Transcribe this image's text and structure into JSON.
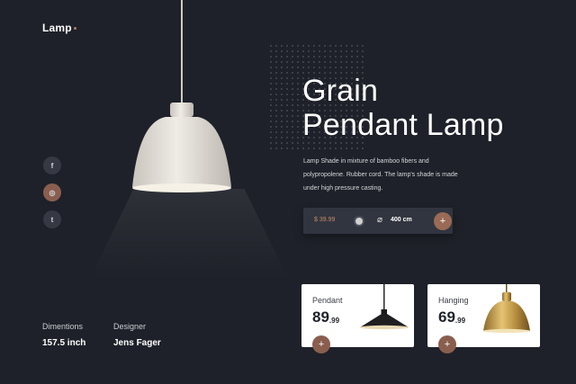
{
  "brand": {
    "name": "Lamp"
  },
  "hero": {
    "title_line1": "Grain",
    "title_line2": "Pendant Lamp",
    "description": "Lamp Shade in mixture of bamboo fibers and polypropolene. Rubber cord. The lamp's shade is made under high pressure casting."
  },
  "social": [
    {
      "glyph": "f",
      "icon": "facebook-icon"
    },
    {
      "glyph": "◎",
      "icon": "instagram-icon"
    },
    {
      "glyph": "t",
      "icon": "twitter-icon"
    }
  ],
  "purchase_bar": {
    "currency": "$",
    "price": "39.99",
    "diameter_symbol": "⌀",
    "size": "400 cm",
    "add_glyph": "+",
    "swatch_color": "#cfcfcf"
  },
  "specs": {
    "dimensions_label": "Dimentions",
    "dimensions_value": "157.5 inch",
    "designer_label": "Designer",
    "designer_value": "Jens Fager"
  },
  "related": [
    {
      "name": "Pendant",
      "price_main": "89",
      "price_cents": ".99",
      "add_glyph": "+"
    },
    {
      "name": "Hanging",
      "price_main": "69",
      "price_cents": ".99",
      "add_glyph": "+"
    }
  ],
  "colors": {
    "background": "#1e2129",
    "accent": "#8a5e4f",
    "price_accent": "#c7886a",
    "card": "#ffffff"
  }
}
